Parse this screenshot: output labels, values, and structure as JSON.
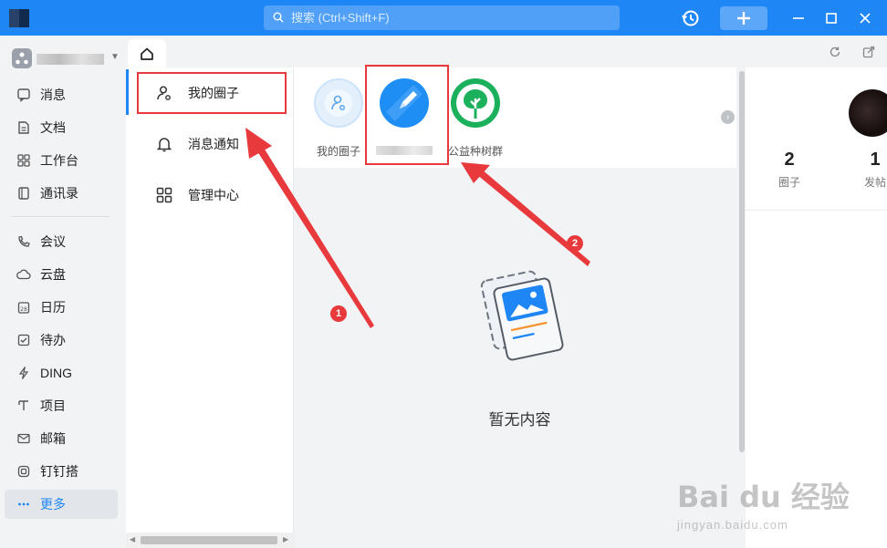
{
  "titlebar": {
    "search_placeholder": "搜索 (Ctrl+Shift+F)",
    "accent_color": "#1f86f5"
  },
  "sidebar": {
    "items": [
      {
        "label": "消息",
        "icon": "message-icon"
      },
      {
        "label": "文档",
        "icon": "document-icon"
      },
      {
        "label": "工作台",
        "icon": "workbench-icon"
      },
      {
        "label": "通讯录",
        "icon": "contacts-icon"
      },
      {
        "label": "会议",
        "icon": "meeting-icon"
      },
      {
        "label": "云盘",
        "icon": "cloud-drive-icon"
      },
      {
        "label": "日历",
        "icon": "calendar-icon"
      },
      {
        "label": "待办",
        "icon": "todo-icon"
      },
      {
        "label": "DING",
        "icon": "ding-icon"
      },
      {
        "label": "项目",
        "icon": "project-icon"
      },
      {
        "label": "邮箱",
        "icon": "mail-icon"
      },
      {
        "label": "钉钉搭",
        "icon": "dingda-icon"
      },
      {
        "label": "更多",
        "icon": "more-icon",
        "active": true
      }
    ]
  },
  "subnav": {
    "items": [
      {
        "label": "我的圈子",
        "icon": "my-circle-icon",
        "active": true
      },
      {
        "label": "消息通知",
        "icon": "bell-icon"
      },
      {
        "label": "管理中心",
        "icon": "grid-icon"
      }
    ]
  },
  "circles": [
    {
      "label": "我的圈子",
      "icon": "my-circle-avatar-icon"
    },
    {
      "label": "",
      "icon": "edit-avatar-icon"
    },
    {
      "label": "公益种树群",
      "icon": "tree-avatar-icon"
    }
  ],
  "main": {
    "empty_text": "暂无内容"
  },
  "profile": {
    "stats": [
      {
        "value": "2",
        "label": "圈子"
      },
      {
        "value": "1",
        "label": "发帖"
      }
    ]
  },
  "annotations": {
    "marker_1": "1",
    "marker_2": "2",
    "color": "#e8393c"
  },
  "watermark": {
    "brand": "Bai  du 经验",
    "url": "jingyan.baidu.com"
  }
}
